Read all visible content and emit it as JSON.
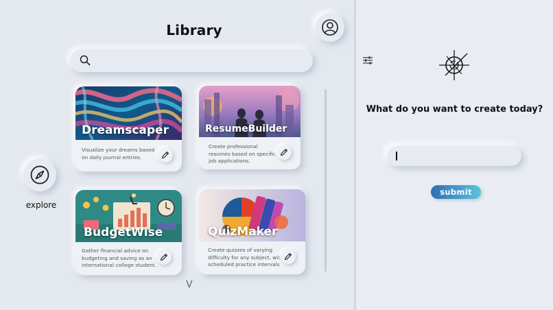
{
  "library": {
    "title": "Library",
    "search": {
      "value": "",
      "placeholder": ""
    },
    "cards": [
      {
        "title": "Dreamscaper",
        "description": "Visualize your dreams based on daily journal entries."
      },
      {
        "title": "ResumeBuilder",
        "description": "Create professional resumes based on specific job applications."
      },
      {
        "title": "BudgetWise",
        "description": "Gather financial advice on budgeting and saving as an international college student."
      },
      {
        "title": "QuizMaker",
        "description": "Create quizzes of varying difficulty for any subject, with scheduled practice intervals"
      }
    ],
    "scroll_down_glyph": "V"
  },
  "nav": {
    "explore_label": "explore"
  },
  "create": {
    "heading": "What do you want to create today?",
    "input": {
      "value": "",
      "placeholder": ""
    },
    "submit_label": "submit"
  },
  "icons": {
    "search": "search-icon",
    "filter": "sliders-icon",
    "profile": "user-icon",
    "explore": "compass-icon",
    "edit": "pencil-icon",
    "logo": "crosshair-logo-icon"
  },
  "colors": {
    "background": "#e6eaf1",
    "submit_gradient_start": "#2f6fb0",
    "submit_gradient_end": "#5bc3de"
  }
}
